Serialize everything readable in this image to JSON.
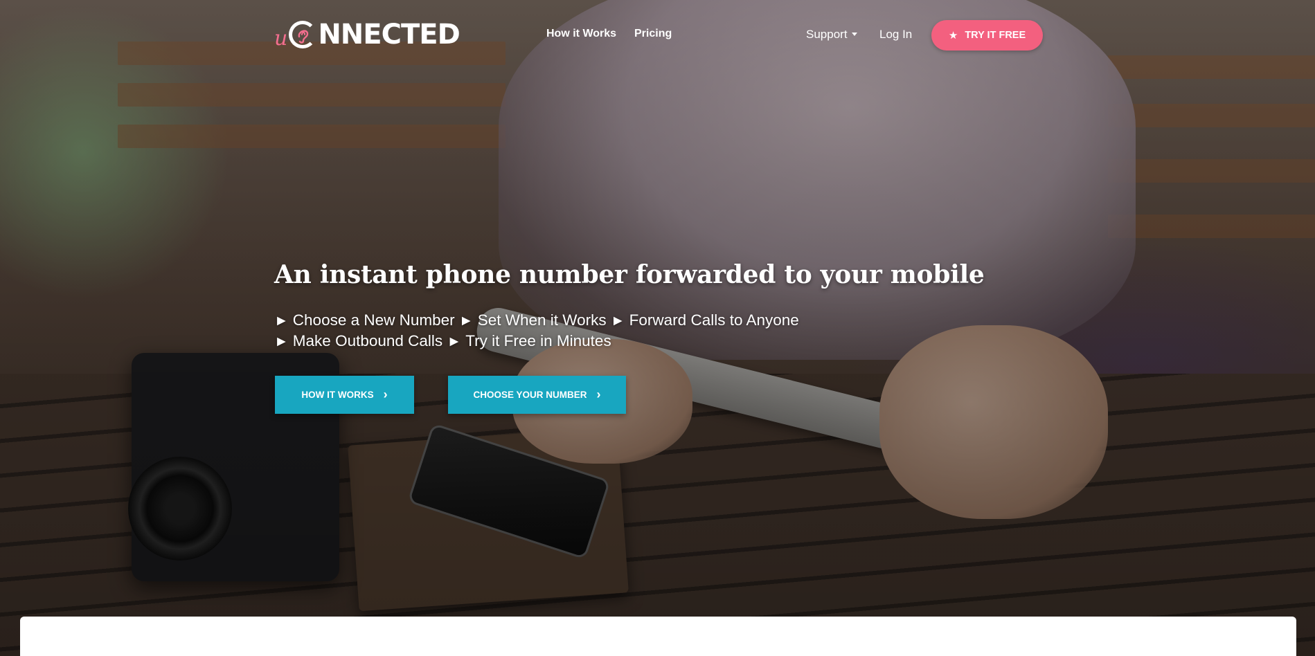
{
  "nav": {
    "logo": {
      "prefix": "u",
      "rest": "NNECTED"
    },
    "how_it_works": "How it Works",
    "pricing": "Pricing",
    "support": "Support",
    "login": "Log In",
    "try_free": "TRY IT FREE"
  },
  "hero": {
    "headline": "An instant phone number forwarded to your mobile",
    "features": [
      "Choose a New Number",
      "Set When it Works",
      "Forward Calls to Anyone",
      "Make Outbound Calls",
      "Try it Free in Minutes"
    ],
    "arrow_glyph": "►",
    "buttons": {
      "how_it_works": "HOW IT WORKS",
      "choose_number": "CHOOSE YOUR NUMBER"
    }
  },
  "colors": {
    "brand_pink": "#f3607f",
    "cta_teal": "#18a6c0"
  }
}
